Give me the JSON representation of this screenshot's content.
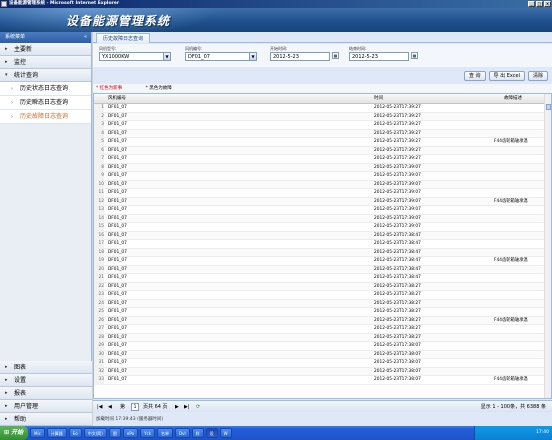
{
  "window": {
    "title": "设备能源管理系统 - Microsoft Internet Explorer",
    "controls": [
      "_",
      "□",
      "×"
    ]
  },
  "banner": {
    "title": "设备能源管理系统"
  },
  "sidebar": {
    "header": "系统菜单",
    "collapse": "«",
    "top_groups": [
      {
        "label": "主要新",
        "expanded": false
      },
      {
        "label": "监控",
        "expanded": false
      },
      {
        "label": "统计查询",
        "expanded": true
      }
    ],
    "sub_items": [
      {
        "label": "历史状态日志查询",
        "active": false
      },
      {
        "label": "历史瞬态日志查询",
        "active": false
      },
      {
        "label": "历史故障日志查询",
        "active": true
      }
    ],
    "bottom_groups": [
      {
        "label": "图表"
      },
      {
        "label": "设置"
      },
      {
        "label": "报表"
      },
      {
        "label": "用户管理"
      },
      {
        "label": "帮助"
      }
    ]
  },
  "tabs": [
    {
      "label": "历史故障日志查询",
      "active": true
    }
  ],
  "filters": {
    "model": {
      "label": "风机型号:",
      "value": "YX1000KW"
    },
    "device": {
      "label": "风机编号:",
      "value": "DF01_07"
    },
    "start": {
      "label": "开始时间:",
      "value": "2012-5-23"
    },
    "end": {
      "label": "结束时间:",
      "value": "2012-5-23"
    }
  },
  "actions": {
    "query": "查 询",
    "export": "导 出 Excel",
    "clear": "清除"
  },
  "legend": {
    "red": "* 红色为新事",
    "black": "* 黑色为故障"
  },
  "grid": {
    "columns": [
      "风机编号",
      "时间",
      "故障描述"
    ],
    "rows": [
      {
        "id": "DF01_07",
        "time": "2012-05-23T17:39:27",
        "desc": ""
      },
      {
        "id": "DF01_07",
        "time": "2012-05-23T17:39:27",
        "desc": ""
      },
      {
        "id": "DF01_07",
        "time": "2012-05-23T17:39:27",
        "desc": ""
      },
      {
        "id": "DF01_07",
        "time": "2012-05-23T17:39:27",
        "desc": ""
      },
      {
        "id": "DF01_07",
        "time": "2012-05-23T17:39:27",
        "desc": "F44齿轮箱轴承温"
      },
      {
        "id": "DF01_07",
        "time": "2012-05-23T17:39:27",
        "desc": ""
      },
      {
        "id": "DF01_07",
        "time": "2012-05-23T17:39:27",
        "desc": ""
      },
      {
        "id": "DF01_07",
        "time": "2012-05-23T17:39:07",
        "desc": ""
      },
      {
        "id": "DF01_07",
        "time": "2012-05-23T17:39:07",
        "desc": ""
      },
      {
        "id": "DF01_07",
        "time": "2012-05-23T17:39:07",
        "desc": ""
      },
      {
        "id": "DF01_07",
        "time": "2012-05-23T17:39:07",
        "desc": ""
      },
      {
        "id": "DF01_07",
        "time": "2012-05-23T17:39:07",
        "desc": "F44齿轮箱轴承温"
      },
      {
        "id": "DF01_07",
        "time": "2012-05-23T17:39:07",
        "desc": ""
      },
      {
        "id": "DF01_07",
        "time": "2012-05-23T17:39:07",
        "desc": ""
      },
      {
        "id": "DF01_07",
        "time": "2012-05-23T17:39:07",
        "desc": ""
      },
      {
        "id": "DF01_07",
        "time": "2012-05-23T17:38:47",
        "desc": ""
      },
      {
        "id": "DF01_07",
        "time": "2012-05-23T17:38:47",
        "desc": ""
      },
      {
        "id": "DF01_07",
        "time": "2012-05-23T17:38:47",
        "desc": ""
      },
      {
        "id": "DF01_07",
        "time": "2012-05-23T17:38:47",
        "desc": "F44齿轮箱轴承温"
      },
      {
        "id": "DF01_07",
        "time": "2012-05-23T17:38:47",
        "desc": ""
      },
      {
        "id": "DF01_07",
        "time": "2012-05-23T17:38:47",
        "desc": ""
      },
      {
        "id": "DF01_07",
        "time": "2012-05-23T17:38:27",
        "desc": ""
      },
      {
        "id": "DF01_07",
        "time": "2012-05-23T17:38:27",
        "desc": ""
      },
      {
        "id": "DF01_07",
        "time": "2012-05-23T17:38:27",
        "desc": ""
      },
      {
        "id": "DF01_07",
        "time": "2012-05-23T17:38:27",
        "desc": ""
      },
      {
        "id": "DF01_07",
        "time": "2012-05-23T17:38:27",
        "desc": "F44齿轮箱轴承温"
      },
      {
        "id": "DF01_07",
        "time": "2012-05-23T17:38:27",
        "desc": ""
      },
      {
        "id": "DF01_07",
        "time": "2012-05-23T17:38:27",
        "desc": ""
      },
      {
        "id": "DF01_07",
        "time": "2012-05-23T17:38:07",
        "desc": ""
      },
      {
        "id": "DF01_07",
        "time": "2012-05-23T17:38:07",
        "desc": ""
      },
      {
        "id": "DF01_07",
        "time": "2012-05-23T17:38:07",
        "desc": ""
      },
      {
        "id": "DF01_07",
        "time": "2012-05-23T17:38:07",
        "desc": ""
      },
      {
        "id": "DF01_07",
        "time": "2012-05-23T17:38:07",
        "desc": "F44齿轮箱轴承温"
      }
    ]
  },
  "pager": {
    "first": "|◀",
    "prev": "◀",
    "page_prefix": "第",
    "page_value": "1",
    "page_suffix": "页共 64 页",
    "next": "▶",
    "last": "▶|",
    "refresh": "⟳",
    "summary": "显示 1 - 100条，共 6388 条"
  },
  "footer": {
    "text": "加载时间 17:39:43 (服务器时间)"
  },
  "taskbar": {
    "start": "开始",
    "items": [
      "Mic",
      "计算器",
      "Eo",
      "中文(简)",
      "图",
      "ePo",
      "Yck",
      "名单",
      "Dvl",
      "样",
      "设",
      "W"
    ],
    "clock": "17:40"
  }
}
